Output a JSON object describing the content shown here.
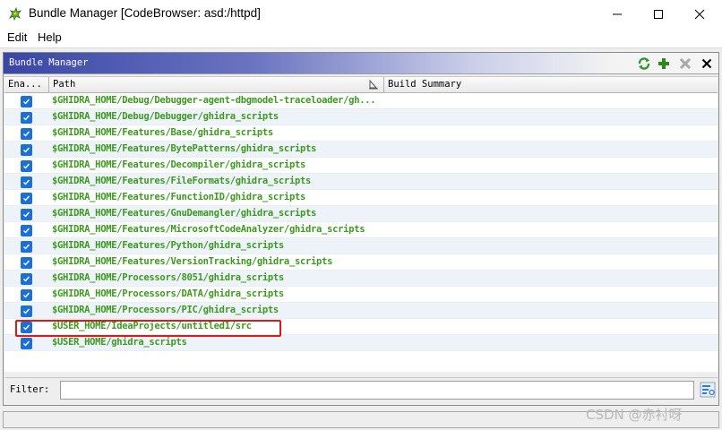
{
  "window": {
    "title": "Bundle Manager [CodeBrowser: asd:/httpd]",
    "min_symbol": "—",
    "max_symbol": "☐",
    "close_symbol": "✕"
  },
  "menu": {
    "edit": "Edit",
    "help": "Help"
  },
  "panel": {
    "title": "Bundle Manager",
    "icons": [
      "refresh-icon",
      "add-icon",
      "remove-icon",
      "close-icon"
    ]
  },
  "table": {
    "columns": {
      "enabled": "Ena...",
      "path": "Path",
      "build_summary": "Build Summary"
    },
    "rows": [
      {
        "enabled": true,
        "path": "$GHIDRA_HOME/Debug/Debugger-agent-dbgmodel-traceloader/gh..."
      },
      {
        "enabled": true,
        "path": "$GHIDRA_HOME/Debug/Debugger/ghidra_scripts"
      },
      {
        "enabled": true,
        "path": "$GHIDRA_HOME/Features/Base/ghidra_scripts"
      },
      {
        "enabled": true,
        "path": "$GHIDRA_HOME/Features/BytePatterns/ghidra_scripts"
      },
      {
        "enabled": true,
        "path": "$GHIDRA_HOME/Features/Decompiler/ghidra_scripts"
      },
      {
        "enabled": true,
        "path": "$GHIDRA_HOME/Features/FileFormats/ghidra_scripts"
      },
      {
        "enabled": true,
        "path": "$GHIDRA_HOME/Features/FunctionID/ghidra_scripts"
      },
      {
        "enabled": true,
        "path": "$GHIDRA_HOME/Features/GnuDemangler/ghidra_scripts"
      },
      {
        "enabled": true,
        "path": "$GHIDRA_HOME/Features/MicrosoftCodeAnalyzer/ghidra_scripts"
      },
      {
        "enabled": true,
        "path": "$GHIDRA_HOME/Features/Python/ghidra_scripts"
      },
      {
        "enabled": true,
        "path": "$GHIDRA_HOME/Features/VersionTracking/ghidra_scripts"
      },
      {
        "enabled": true,
        "path": "$GHIDRA_HOME/Processors/8051/ghidra_scripts"
      },
      {
        "enabled": true,
        "path": "$GHIDRA_HOME/Processors/DATA/ghidra_scripts"
      },
      {
        "enabled": true,
        "path": "$GHIDRA_HOME/Processors/PIC/ghidra_scripts"
      },
      {
        "enabled": true,
        "path": "$USER_HOME/IdeaProjects/untitled1/src"
      },
      {
        "enabled": true,
        "path": "$USER_HOME/ghidra_scripts"
      }
    ]
  },
  "filter": {
    "label": "Filter:",
    "value": ""
  },
  "watermark": "CSDN @赤衬呀",
  "colors": {
    "path_text": "#3c9a1e",
    "checkbox": "#1e6fd3",
    "highlight": "#e01818",
    "header_gradient_start": "#3a46a6"
  }
}
